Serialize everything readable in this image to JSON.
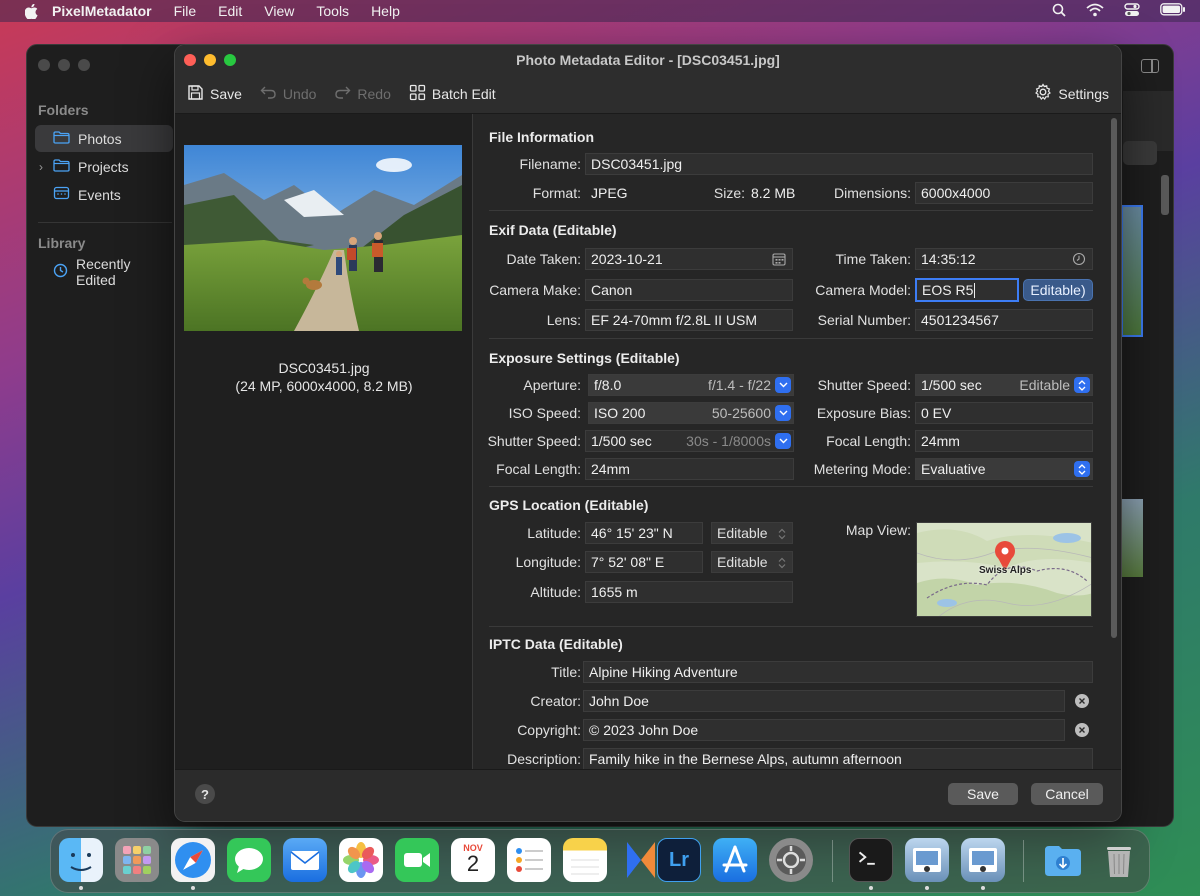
{
  "menubar": {
    "app_name": "PixelMetadator",
    "items": [
      "File",
      "Edit",
      "View",
      "Tools",
      "Help"
    ]
  },
  "background_window": {
    "sidebar": {
      "folders_header": "Folders",
      "items": [
        {
          "label": "Photos",
          "icon": "folder-icon",
          "selected": true
        },
        {
          "label": "Projects",
          "icon": "folder-icon",
          "selected": false
        },
        {
          "label": "Events",
          "icon": "calendar-icon",
          "selected": false
        }
      ],
      "library_header": "Library",
      "library_items": [
        {
          "label": "Recently Edited",
          "icon": "clock-icon"
        }
      ]
    }
  },
  "window": {
    "title": "Photo Metadata Editor - [DSC03451.jpg]",
    "toolbar": {
      "save": "Save",
      "undo": "Undo",
      "redo": "Redo",
      "batch_edit": "Batch Edit",
      "settings": "Settings"
    },
    "preview": {
      "filename": "DSC03451.jpg",
      "details": "(24 MP, 6000x4000, 8.2 MB)"
    },
    "file_info": {
      "title": "File Information",
      "filename_label": "Filename:",
      "filename": "DSC03451.jpg",
      "format_label": "Format:",
      "format": "JPEG",
      "size_label": "Size:",
      "size": "8.2 MB",
      "dimensions_label": "Dimensions:",
      "dimensions": "6000x4000"
    },
    "exif": {
      "title": "Exif Data (Editable)",
      "date_label": "Date Taken:",
      "date": "2023-10-21",
      "time_label": "Time Taken:",
      "time": "14:35:12",
      "make_label": "Camera Make:",
      "make": "Canon",
      "model_label": "Camera Model:",
      "model": "EOS R5",
      "model_pill": "Editable)",
      "lens_label": "Lens:",
      "lens": "EF 24-70mm f/2.8L II USM",
      "serial_label": "Serial Number:",
      "serial": "4501234567"
    },
    "exposure": {
      "title": "Exposure Settings (Editable)",
      "aperture_label": "Aperture:",
      "aperture": "f/8.0",
      "aperture_range": "f/1.4 - f/22",
      "shutter_label": "Shutter Speed:",
      "shutter": "1/500 sec",
      "shutter_mode": "Editable",
      "iso_label": "ISO Speed:",
      "iso": "ISO 200",
      "iso_range": "50-25600",
      "bias_label": "Exposure Bias:",
      "bias": "0 EV",
      "shutter2_label": "Shutter Speed:",
      "shutter2": "1/500 sec",
      "shutter2_range": "30s - 1/8000s",
      "focal_label": "Focal Length:",
      "focal": "24mm",
      "focal2_label": "Focal Length:",
      "focal2": "24mm",
      "metering_label": "Metering Mode:",
      "metering": "Evaluative"
    },
    "gps": {
      "title": "GPS Location (Editable)",
      "lat_label": "Latitude:",
      "lat": "46° 15' 23\" N",
      "lat_mode": "Editable",
      "lon_label": "Longitude:",
      "lon": "7° 52' 08\" E",
      "lon_mode": "Editable",
      "alt_label": "Altitude:",
      "alt": "1655 m",
      "map_label": "Map View:",
      "map_pin": "Swiss Alps"
    },
    "iptc": {
      "title": "IPTC Data (Editable)",
      "title_label": "Title:",
      "title_value": "Alpine Hiking Adventure",
      "creator_label": "Creator:",
      "creator": "John Doe",
      "copyright_label": "Copyright:",
      "copyright": "© 2023 John Doe",
      "description_label": "Description:",
      "description": "Family hike in the Bernese Alps, autumn afternoon"
    },
    "footer": {
      "help": "?",
      "save": "Save",
      "cancel": "Cancel"
    }
  },
  "dock": {
    "calendar_month": "NOV",
    "calendar_day": "2",
    "lightroom": "Lr",
    "apps": [
      "finder-icon",
      "launchpad-icon",
      "safari-icon",
      "messages-icon",
      "mail-icon",
      "photos-icon",
      "facetime-icon",
      "calendar-icon",
      "reminders-icon",
      "notes-icon",
      "pixelmetadator-icon",
      "lightroom-icon",
      "app-store-icon",
      "system-settings-icon",
      "terminal-icon",
      "preview-icon",
      "preview-icon",
      "downloads-icon",
      "trash-icon"
    ]
  },
  "colors": {
    "accent": "#2f6ff0",
    "window_bg": "#262626"
  }
}
